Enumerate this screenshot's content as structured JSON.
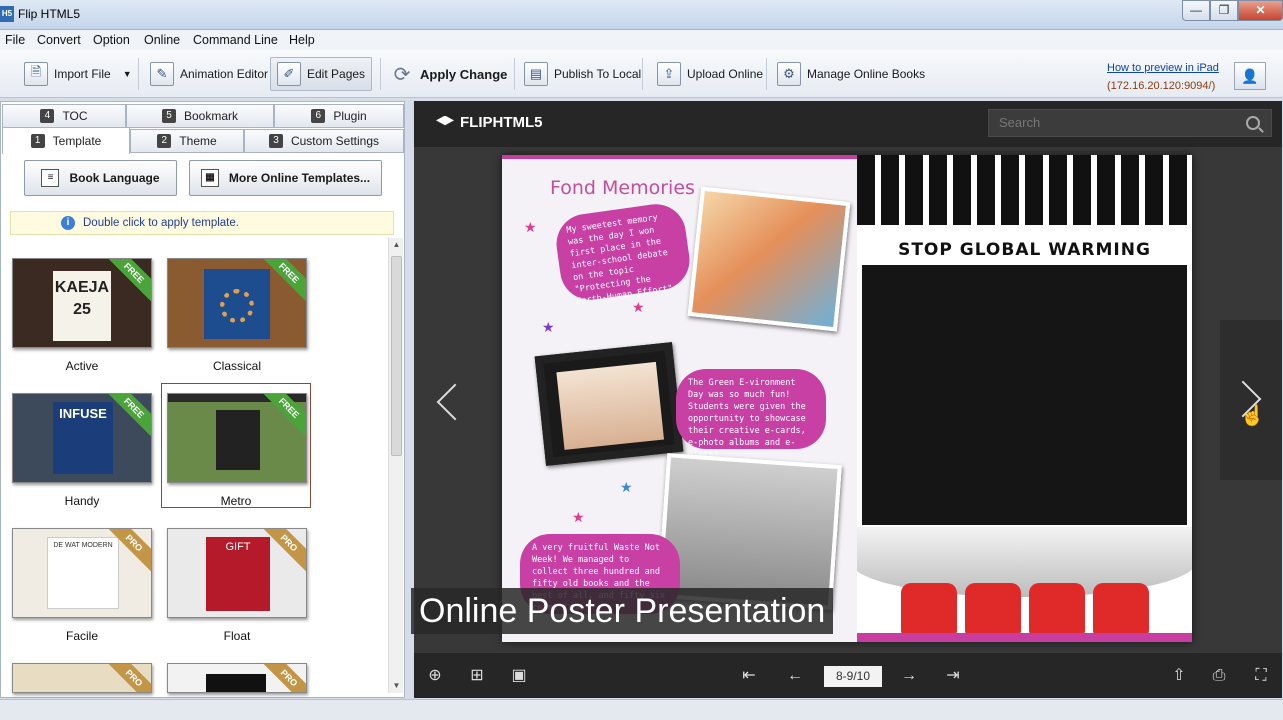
{
  "window": {
    "app_icon": "H5",
    "title": "Flip HTML5",
    "minimize": "—",
    "maximize": "❐",
    "close": "✕"
  },
  "menu": [
    "File",
    "Convert",
    "Option",
    "Online",
    "Command Line",
    "Help"
  ],
  "toolbar": {
    "import_file": "Import File",
    "animation_editor": "Animation Editor",
    "edit_pages": "Edit Pages",
    "apply_change": "Apply Change",
    "publish_local": "Publish To Local",
    "upload_online": "Upload Online",
    "manage_online": "Manage Online Books",
    "preview_link": "How to preview in iPad",
    "preview_ip": "(172.16.20.120:9094/)"
  },
  "tabs": [
    {
      "num": "4",
      "label": "TOC"
    },
    {
      "num": "5",
      "label": "Bookmark"
    },
    {
      "num": "6",
      "label": "Plugin"
    },
    {
      "num": "1",
      "label": "Template"
    },
    {
      "num": "2",
      "label": "Theme"
    },
    {
      "num": "3",
      "label": "Custom Settings"
    }
  ],
  "panel": {
    "book_language": "Book Language",
    "more_templates": "More Online Templates...",
    "hint": "Double click to apply template."
  },
  "templates": [
    {
      "name": "Active",
      "badge": "FREE",
      "text": "KAEJA 25"
    },
    {
      "name": "Classical",
      "badge": "FREE"
    },
    {
      "name": "Handy",
      "badge": "FREE",
      "text": "INFUSE"
    },
    {
      "name": "Metro",
      "badge": "FREE"
    },
    {
      "name": "Facile",
      "badge": "PRO",
      "text": "DE WAT MODERN"
    },
    {
      "name": "Float",
      "badge": "PRO",
      "text": "GIFT"
    }
  ],
  "extra_badges": [
    "PRO",
    "PRO"
  ],
  "preview": {
    "logo": "FLIPHTML5",
    "search_placeholder": "Search",
    "left_page_title": "Fond Memories",
    "blob1": "My sweetest memory was the day I won first place in the inter-school debate on the topic \"Protecting the Earth-Human Effort\"",
    "blob2": "The Green E-vironment Day was so much fun! Students were given the opportunity to showcase their creative e-cards, e-photo albums and e-gifts!",
    "blob3": "A very fruitful Waste Not Week! We managed to collect three hundred and fifty old books and the best of all, and fifty six reams from",
    "right_page_title": "STOP GLOBAL WARMING",
    "caption": "Online Poster Presentation",
    "page_indicator": "8-9/10"
  },
  "colors": {
    "accent_pink": "#c940a4",
    "free_badge": "#4aa43a",
    "pro_badge": "#c29547",
    "seat_red": "#e02a2a"
  }
}
